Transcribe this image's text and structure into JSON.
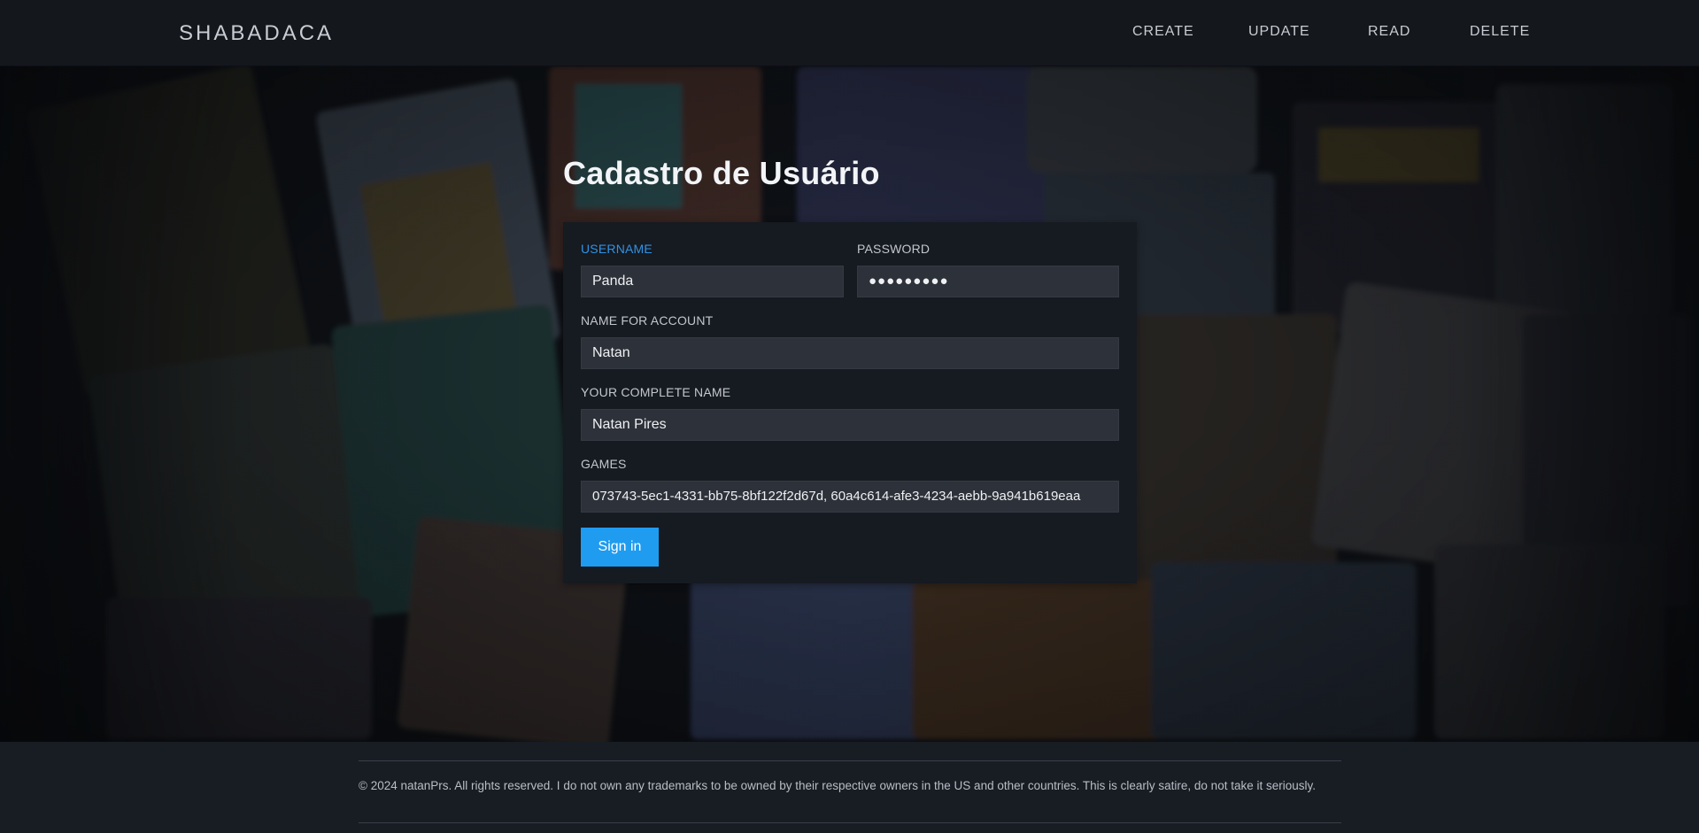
{
  "navbar": {
    "brand": "SHABADACA",
    "links": [
      "CREATE",
      "UPDATE",
      "READ",
      "DELETE"
    ]
  },
  "form": {
    "title": "Cadastro de Usuário",
    "username": {
      "label": "USERNAME",
      "value": "Panda"
    },
    "password": {
      "label": "PASSWORD",
      "value": "●●●●●●●●●"
    },
    "account_name": {
      "label": "NAME FOR ACCOUNT",
      "value": "Natan"
    },
    "complete_name": {
      "label": "YOUR COMPLETE NAME",
      "value": "Natan Pires"
    },
    "games": {
      "label": "GAMES",
      "value": "073743-5ec1-4331-bb75-8bf122f2d67d, 60a4c614-afe3-4234-aebb-9a941b619eaa"
    },
    "submit_label": "Sign in"
  },
  "footer": {
    "text": "© 2024 natanPrs. All rights reserved. I do not own any trademarks to be owned by their respective owners in the US and other countries. This is clearly satire, do not take it seriously."
  },
  "colors": {
    "accent": "#1f9cf0",
    "active_label": "#2f93e6",
    "card": "#161a21",
    "input": "#2d3139"
  }
}
